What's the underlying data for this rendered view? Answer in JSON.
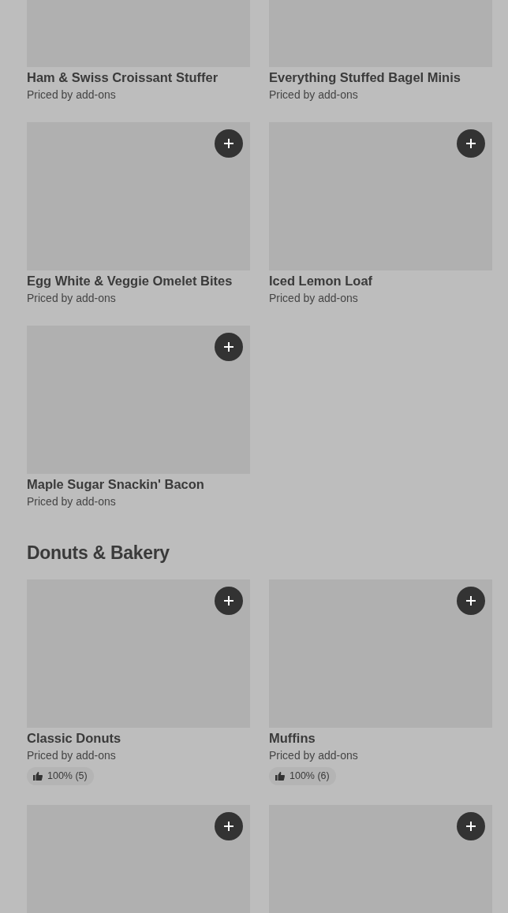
{
  "sections": [
    {
      "items": [
        {
          "kind": "item",
          "title": "Ham & Swiss Croissant Stuffer",
          "price_note": "Priced by add-ons"
        },
        {
          "kind": "item",
          "title": "Everything Stuffed Bagel Minis",
          "price_note": "Priced by add-ons"
        },
        {
          "kind": "item",
          "title": "Egg White & Veggie Omelet Bites",
          "price_note": "Priced by add-ons"
        },
        {
          "kind": "item",
          "title": "Iced Lemon Loaf",
          "price_note": "Priced by add-ons"
        },
        {
          "kind": "item",
          "title": "Maple Sugar Snackin' Bacon",
          "price_note": "Priced by add-ons"
        }
      ]
    },
    {
      "heading": "Donuts & Bakery",
      "items": [
        {
          "kind": "item",
          "title": "Classic Donuts",
          "price_note": "Priced by add-ons",
          "rating": "100% (5)"
        },
        {
          "kind": "item",
          "title": "Muffins",
          "price_note": "Priced by add-ons",
          "rating": "100% (6)"
        },
        {
          "kind": "picture"
        },
        {
          "kind": "picture"
        }
      ]
    }
  ]
}
